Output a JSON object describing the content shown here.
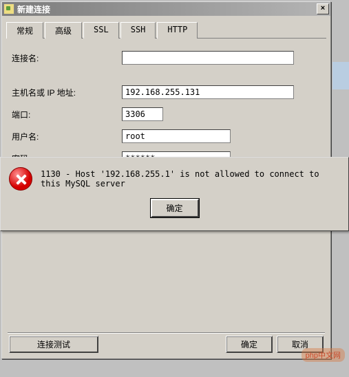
{
  "window": {
    "title": "新建连接"
  },
  "tabs": {
    "general": "常规",
    "advanced": "高级",
    "ssl": "SSL",
    "ssh": "SSH",
    "http": "HTTP"
  },
  "form": {
    "connection_name_label": "连接名:",
    "connection_name_value": "",
    "host_label": "主机名或 IP 地址:",
    "host_value": "192.168.255.131",
    "port_label": "端口:",
    "port_value": "3306",
    "user_label": "用户名:",
    "user_value": "root",
    "password_label": "密码:",
    "password_value": "******"
  },
  "buttons": {
    "test": "连接测试",
    "ok": "确定",
    "cancel": "取消"
  },
  "error": {
    "message": "1130 - Host '192.168.255.1' is not allowed to connect to this MySQL server",
    "ok": "确定"
  },
  "watermark": "php中文网"
}
